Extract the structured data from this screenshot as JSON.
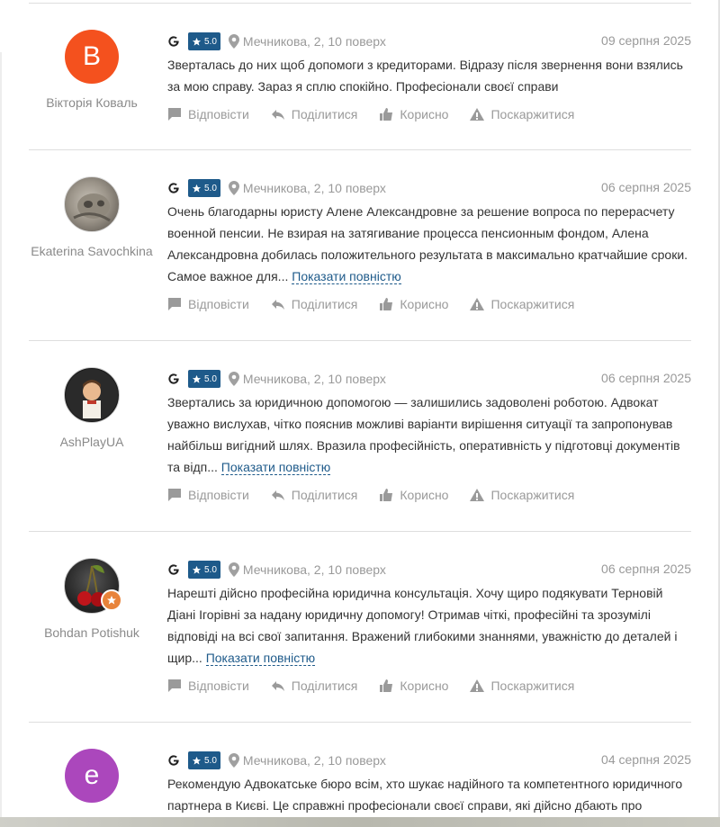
{
  "common": {
    "location": "Мечникова, 2, 10 поверх",
    "rating": "5.0",
    "show_more": "Показати повністю",
    "actions": {
      "reply": "Відповісти",
      "share": "Поділитися",
      "helpful": "Корисно",
      "report": "Поскаржитися"
    }
  },
  "reviews": [
    {
      "author": "Вікторія Коваль",
      "date": "09 серпня 2025",
      "avatar_letter": "B",
      "avatar_color": "#f4511e",
      "text": "Зверталась до них щоб допомоги з кредиторами. Відразу після звернення вони взялись за мою справу. Зараз я сплю спокійно. Професіонали своєї справи"
    },
    {
      "author": "Ekaterina Savochkina",
      "date": "06 серпня 2025",
      "text": "Очень благодарны юристу Алене Александровне за решение вопроса по перерасчету военной пенсии. Не взирая на затягивание процесса пенсионным фондом, Алена Александровна добилась положительного результата в максимально кратчайшие сроки. Самое важное для..."
    },
    {
      "author": "AshPlayUA",
      "date": "06 серпня 2025",
      "text": "Звертались за юридичною допомогою — залишились задоволені роботою. Адвокат уважно вислухав, чітко пояснив можливі варіанти вирішення ситуації та запропонував найбільш вигідний шлях. Вразила професійність, оперативність у підготовці документів та відп..."
    },
    {
      "author": "Bohdan Potishuk",
      "date": "06 серпня 2025",
      "text": "Нарешті дійсно професійна юридична консультація. Хочу щиро подякувати Терновій Діані Ігорівні за надану юридичну допомогу! Отримав чіткі, професійні та зрозумілі відповіді на всі свої запитання. Вражений глибокими знаннями, уважністю до деталей і щир..."
    },
    {
      "author": "",
      "date": "04 серпня 2025",
      "avatar_letter": "e",
      "avatar_color": "#ab47bc",
      "text": "Рекомендую Адвокатське бюро всім, хто шукає надійного та компетентного юридичного партнера в Києві. Це справжні професіонали своєї справи, які дійсно дбають про"
    }
  ]
}
